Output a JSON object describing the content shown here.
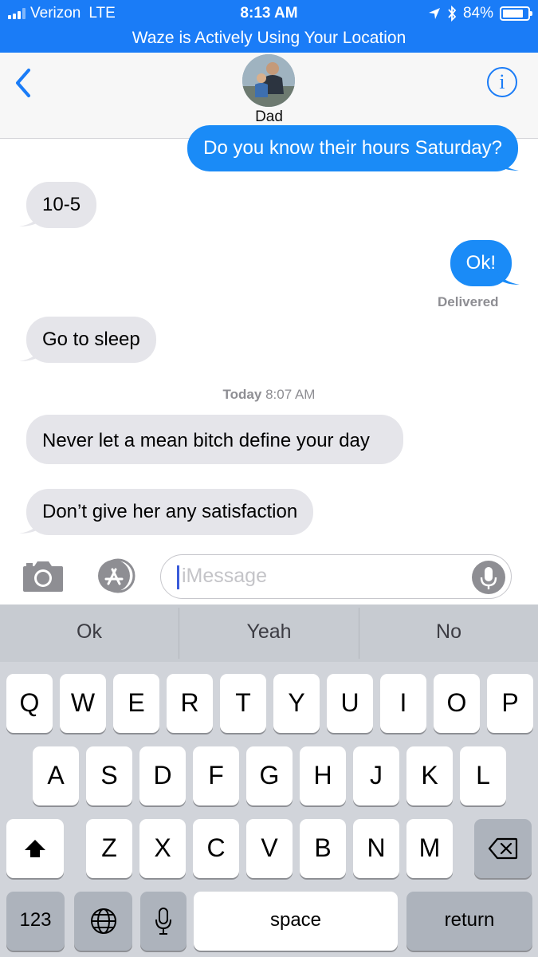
{
  "status_bar": {
    "carrier": "Verizon",
    "network": "LTE",
    "time": "8:13 AM",
    "battery": "84%",
    "battery_level": 0.84
  },
  "location_banner": "Waze is Actively Using Your Location",
  "header": {
    "contact_name": "Dad",
    "info_label": "i"
  },
  "messages": [
    {
      "direction": "outgoing",
      "text": "Do you know their hours Saturday?"
    },
    {
      "direction": "incoming",
      "text": "10-5"
    },
    {
      "direction": "outgoing",
      "text": "Ok!"
    },
    {
      "direction": "incoming",
      "text": "Go to sleep"
    },
    {
      "direction": "incoming",
      "text": "Never let a mean bitch define your day"
    },
    {
      "direction": "incoming",
      "text": "Don’t give her any satisfaction"
    }
  ],
  "delivered_label": "Delivered",
  "timestamp": {
    "day": "Today",
    "time": "8:07 AM"
  },
  "input": {
    "placeholder": "iMessage"
  },
  "predictions": [
    "Ok",
    "Yeah",
    "No"
  ],
  "keyboard": {
    "row1": [
      "Q",
      "W",
      "E",
      "R",
      "T",
      "Y",
      "U",
      "I",
      "O",
      "P"
    ],
    "row2": [
      "A",
      "S",
      "D",
      "F",
      "G",
      "H",
      "J",
      "K",
      "L"
    ],
    "row3": [
      "Z",
      "X",
      "C",
      "V",
      "B",
      "N",
      "M"
    ],
    "numbers_label": "123",
    "space_label": "space",
    "return_label": "return"
  },
  "colors": {
    "ios_blue": "#1a7cf7",
    "outgoing_bubble": "#1a8bf7",
    "incoming_bubble": "#e5e5ea",
    "keyboard_bg": "#d1d4da"
  },
  "icons": [
    "back-chevron-icon",
    "info-icon",
    "camera-icon",
    "app-store-icon",
    "microphone-icon",
    "shift-icon",
    "backspace-icon",
    "globe-icon",
    "location-arrow-icon",
    "bluetooth-icon",
    "battery-icon"
  ]
}
